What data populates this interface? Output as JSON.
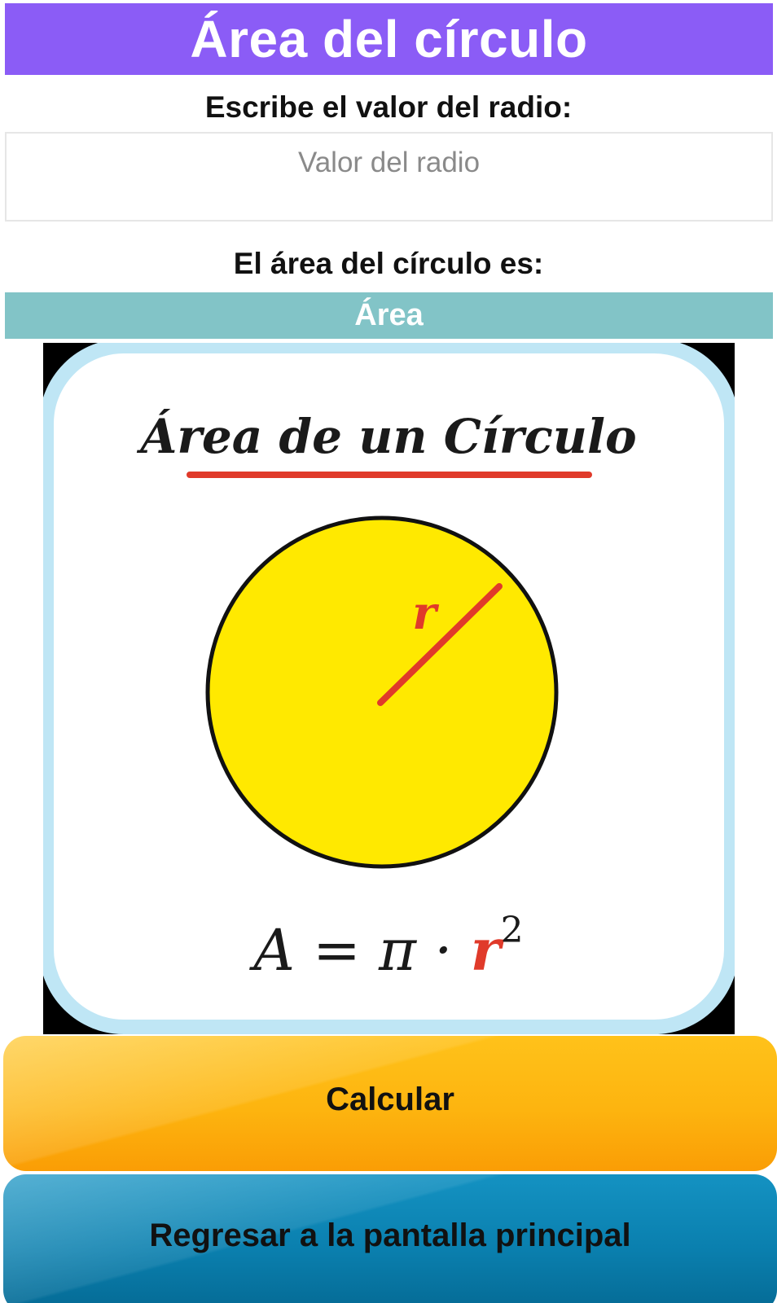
{
  "header": {
    "title": "Área del círculo"
  },
  "form": {
    "prompt_label": "Escribe el valor del radio:",
    "radius_placeholder": "Valor del radio",
    "radius_value": ""
  },
  "result": {
    "label": "El área del círculo es:",
    "output_text": "Área"
  },
  "illustration": {
    "heading": "Área de un Círculo",
    "radius_label": "r",
    "formula_lhs": "A = π · ",
    "formula_r": "r",
    "formula_exp": "2"
  },
  "buttons": {
    "calculate_label": "Calcular",
    "back_label": "Regresar a la pantalla principal"
  },
  "colors": {
    "title_bg": "#8b5cf6",
    "output_bg": "#82c4c7",
    "calculate_bg": "#fdb40f",
    "back_bg": "#0a7fae",
    "circle_fill": "#ffe900",
    "accent_red": "#e03a2a",
    "card_border": "#bfe6f5"
  }
}
